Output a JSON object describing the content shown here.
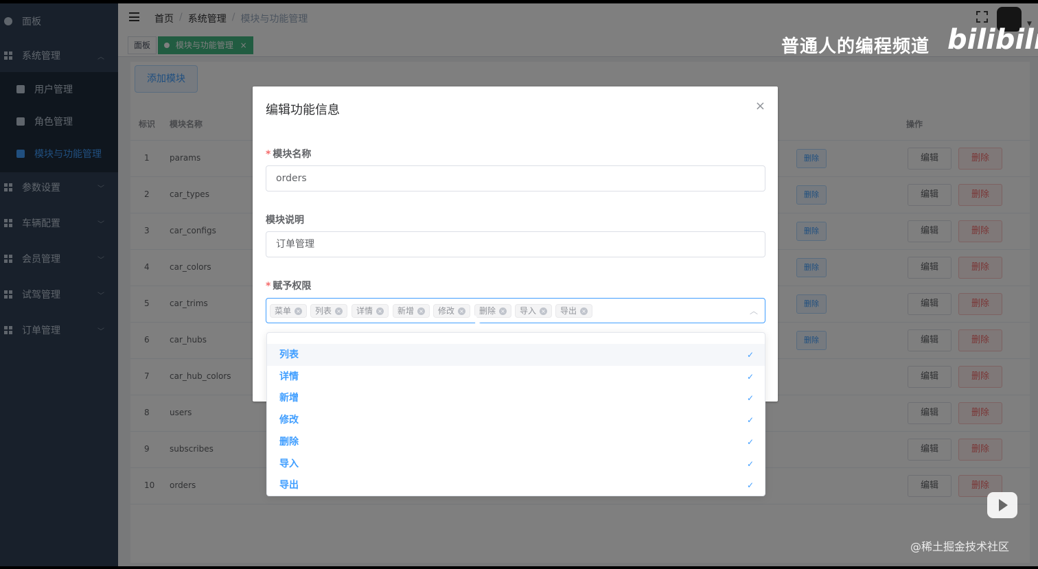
{
  "sidebar": {
    "items": [
      {
        "label": "面板"
      },
      {
        "label": "系统管理"
      },
      {
        "label": "参数设置"
      },
      {
        "label": "车辆配置"
      },
      {
        "label": "会员管理"
      },
      {
        "label": "试驾管理"
      },
      {
        "label": "订单管理"
      }
    ],
    "sub_items": [
      {
        "label": "用户管理"
      },
      {
        "label": "角色管理"
      },
      {
        "label": "模块与功能管理"
      }
    ]
  },
  "header": {
    "breadcrumb": [
      "首页",
      "系统管理",
      "模块与功能管理"
    ],
    "separator": "/"
  },
  "tagsview": {
    "tags": [
      "面板",
      "模块与功能管理"
    ],
    "active_close": "×"
  },
  "main": {
    "add_button": "添加模块",
    "columns": {
      "id": "标识",
      "name": "模块名称",
      "actions": "操作"
    },
    "rows": [
      {
        "id": "1",
        "name": "params"
      },
      {
        "id": "2",
        "name": "car_types"
      },
      {
        "id": "3",
        "name": "car_configs"
      },
      {
        "id": "4",
        "name": "car_colors"
      },
      {
        "id": "5",
        "name": "car_trims"
      },
      {
        "id": "6",
        "name": "car_hubs"
      },
      {
        "id": "7",
        "name": "car_hub_colors"
      },
      {
        "id": "8",
        "name": "users"
      },
      {
        "id": "9",
        "name": "subscribes"
      },
      {
        "id": "10",
        "name": "orders"
      }
    ],
    "edit_label": "编辑",
    "delete_label": "删除"
  },
  "dialog": {
    "title": "编辑功能信息",
    "close": "×",
    "name_label": "模块名称",
    "name_value": "orders",
    "desc_label": "模块说明",
    "desc_value": "订单管理",
    "perm_label": "赋予权限",
    "required_mark": "*",
    "chips": [
      "菜单",
      "列表",
      "详情",
      "新增",
      "修改",
      "删除",
      "导入",
      "导出"
    ],
    "chip_close": "×",
    "arrow": "^"
  },
  "dropdown": {
    "options": [
      "列表",
      "详情",
      "新增",
      "修改",
      "删除",
      "导入",
      "导出"
    ],
    "check": "✓"
  },
  "watermark": {
    "channel": "普通人的编程频道",
    "logo": "bilibili",
    "credit": "@稀土掘金技术社区"
  },
  "colors": {
    "sidebar_bg": "#304156",
    "active": "#409eff",
    "tag_active": "#42b983",
    "danger": "#f56c6c"
  }
}
